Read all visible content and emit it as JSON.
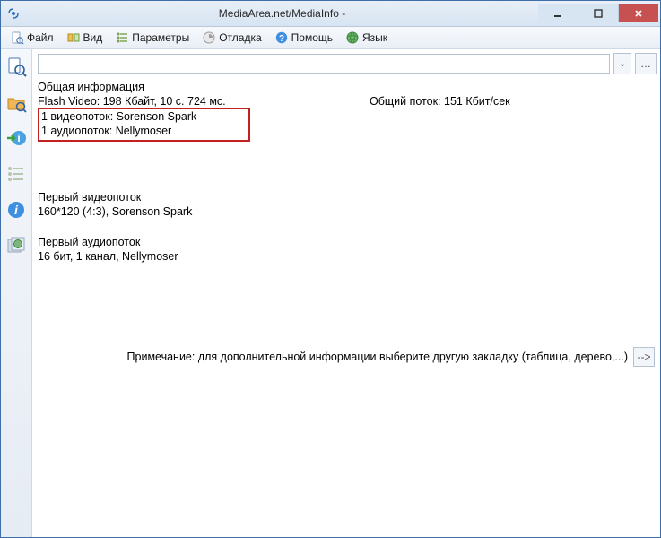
{
  "window": {
    "title": "MediaArea.net/MediaInfo -"
  },
  "menu": {
    "file": "Файл",
    "view": "Вид",
    "params": "Параметры",
    "debug": "Отладка",
    "help": "Помощь",
    "lang": "Язык"
  },
  "path": {
    "value": "",
    "placeholder": ""
  },
  "general": {
    "header": "Общая информация",
    "line1_left": "Flash Video: 198 Кбайт, 10 с. 724 мс.",
    "line1_right": "Общий поток: 151 Кбит/сек",
    "line2": "1 видеопоток: Sorenson Spark",
    "line3": "1 аудиопоток: Nellymoser"
  },
  "video": {
    "header": "Первый видеопоток",
    "line1": "160*120 (4:3), Sorenson Spark"
  },
  "audio": {
    "header": "Первый аудиопоток",
    "line1": "16 бит, 1 канал, Nellymoser"
  },
  "note": {
    "text": "Примечание: для дополнительной информации выберите другую закладку (таблица, дерево,...)",
    "go": "-->"
  },
  "dropdown_glyph": "⌄",
  "browse_glyph": "…"
}
